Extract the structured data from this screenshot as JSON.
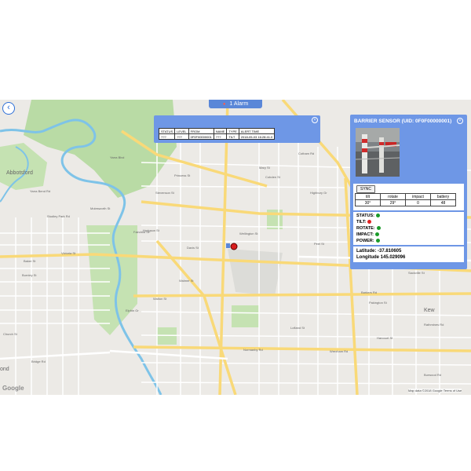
{
  "alarm_tab": {
    "icon": "bell-icon",
    "label": "1 Alarm",
    "color": "#5a87d8"
  },
  "back_button": {
    "icon": "chevron-left-icon"
  },
  "alarm_popup": {
    "headers": [
      "STATUS",
      "LEVEL",
      "FROM",
      "NAME",
      "TYPE",
      "ALERT TIME"
    ],
    "row": [
      "???",
      "???",
      "0F0F00000001",
      "???",
      "TILT",
      "2018-05-03 16:28:41.0"
    ]
  },
  "sensor_panel": {
    "title": "BARRIER SENSOR (UID: 0F0F00000001)",
    "sync_label": "SYNC",
    "reading_headers": [
      "tilt",
      "rotate",
      "impact",
      "battery"
    ],
    "reading_values": [
      "30°",
      "29°",
      "0",
      "48"
    ],
    "status": [
      {
        "label": "STATUS:",
        "color": "#1a9a2a"
      },
      {
        "label": "TILT:",
        "color": "#e02020"
      },
      {
        "label": "ROTATE:",
        "color": "#1a9a2a"
      },
      {
        "label": "IMPACT:",
        "color": "#1a9a2a"
      },
      {
        "label": "POWER:",
        "color": "#1a9a2a"
      }
    ],
    "latitude": "Latitude: -37.810605",
    "longitude": "Longitude 145.029096"
  },
  "map": {
    "place_labels": [
      "Abbotsford",
      "Kew",
      "ond"
    ],
    "road_labels": [
      "Victoria St",
      "Barkers Rd",
      "Wellington St",
      "Yarra Blvd",
      "Yarra Bend Rd",
      "Studley Park Rd",
      "Molesworth St",
      "Princess St",
      "Mary St",
      "Baker St",
      "Church St",
      "Burnley St",
      "Walmer St",
      "Hodgson St",
      "Stevenson St",
      "Cotham Rd",
      "Highbury Gr",
      "Peel St",
      "Cobden St",
      "Sackville St",
      "Pakington St",
      "Rathmines Rd",
      "Harcourt St",
      "Burwood Rd",
      "Lofland St",
      "Wrexham Rd",
      "Normanby Rd",
      "Elphin Gr",
      "Bridge Rd",
      "Fairchild St",
      "Davis St",
      "Walton St"
    ],
    "google_logo": "Google",
    "credit_data": "Map data ©2018 Google",
    "credit_terms": "Terms of Use",
    "marker_color": "#d81e1e"
  }
}
